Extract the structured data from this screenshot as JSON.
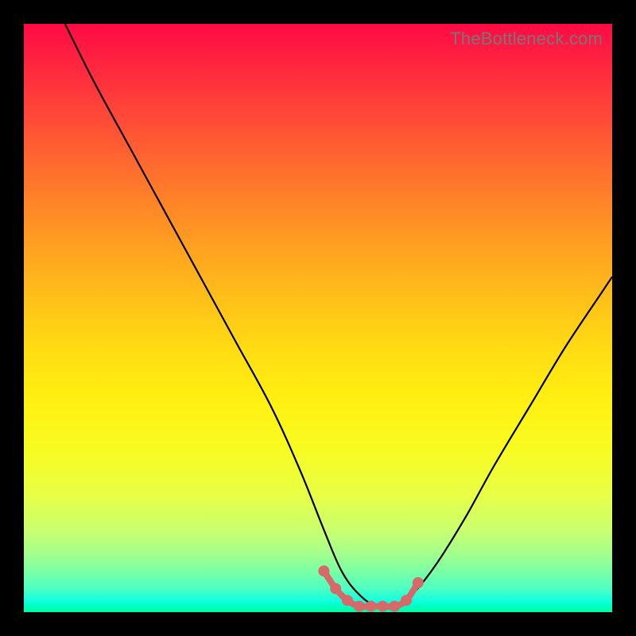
{
  "watermark": "TheBottleneck.com",
  "chart_data": {
    "type": "line",
    "title": "",
    "xlabel": "",
    "ylabel": "",
    "xlim": [
      0,
      100
    ],
    "ylim": [
      0,
      100
    ],
    "grid": false,
    "legend": false,
    "series": [
      {
        "name": "bottleneck-curve",
        "x": [
          7,
          12,
          18,
          24,
          30,
          36,
          42,
          47,
          51,
          54,
          57,
          60,
          63,
          66,
          70,
          75,
          80,
          86,
          92,
          98,
          100
        ],
        "y": [
          100,
          90,
          79,
          68,
          57,
          46,
          35,
          24,
          14,
          7,
          3,
          1,
          1,
          3,
          8,
          16,
          25,
          35,
          45,
          54,
          57
        ]
      }
    ],
    "markers": {
      "name": "valley-zone",
      "x": [
        51,
        53,
        55,
        57,
        59,
        61,
        63,
        65,
        67
      ],
      "y": [
        7,
        4,
        2,
        1,
        1,
        1,
        1,
        2,
        5
      ],
      "color": "#d66a6a",
      "size": 7
    },
    "colors": {
      "curve": "#000000",
      "marker": "#d66a6a",
      "gradient_top": "#ff0a45",
      "gradient_mid": "#ffde13",
      "gradient_bottom": "#00ff9a"
    }
  }
}
